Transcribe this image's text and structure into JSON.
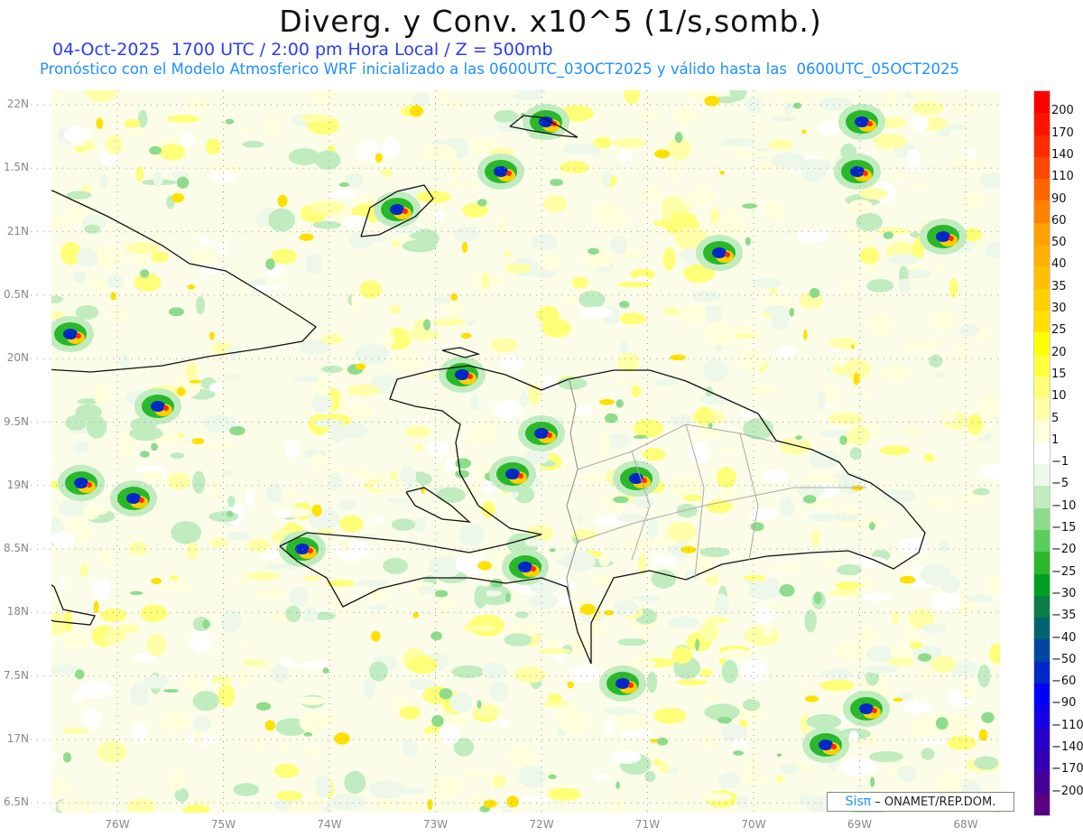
{
  "header": {
    "title": "Diverg. y Conv. x10^5 (1/s,somb.)",
    "subtitle1": "04-Oct-2025  1700 UTC / 2:00 pm Hora Local / Z = 500mb",
    "subtitle2": "Pronóstico con el Modelo Atmosferico WRF inicializado a las 0600UTC_03OCT2025 y válido hasta las  0600UTC_05OCT2025"
  },
  "axes": {
    "lat_labels": [
      "22N",
      "1.5N",
      "21N",
      "0.5N",
      "20N",
      "9.5N",
      "19N",
      "8.5N",
      "18N",
      "7.5N",
      "17N",
      "6.5N"
    ],
    "lon_labels": [
      "76W",
      "75W",
      "74W",
      "73W",
      "72W",
      "71W",
      "70W",
      "69W",
      "68W"
    ]
  },
  "colorbar": {
    "labels": [
      "200",
      "170",
      "140",
      "110",
      "90",
      "60",
      "50",
      "40",
      "35",
      "30",
      "25",
      "20",
      "15",
      "10",
      "5",
      "1",
      "−1",
      "−5",
      "−10",
      "−15",
      "−20",
      "−25",
      "−30",
      "−35",
      "−40",
      "−50",
      "−60",
      "−90",
      "−110",
      "−140",
      "−170",
      "−200"
    ],
    "colors": [
      "#fe0000",
      "#ff1400",
      "#ff2c00",
      "#ff4800",
      "#ff6400",
      "#ff8200",
      "#ffa000",
      "#ffb000",
      "#ffc000",
      "#ffd000",
      "#ffe000",
      "#ffff00",
      "#ffff3c",
      "#ffff78",
      "#ffffa8",
      "#ffffdc",
      "#ffffff",
      "#eef8ea",
      "#c0ecc0",
      "#8cdc8c",
      "#5acc5a",
      "#2ab82a",
      "#00a020",
      "#0a7e46",
      "#00646e",
      "#0046a0",
      "#0028c8",
      "#0000ff",
      "#1400e6",
      "#2800cc",
      "#3200b4",
      "#46009a",
      "#5a0082"
    ]
  },
  "credit": {
    "brand": "Sisπ",
    "text": " – ONAMET/REP.DOM."
  }
}
